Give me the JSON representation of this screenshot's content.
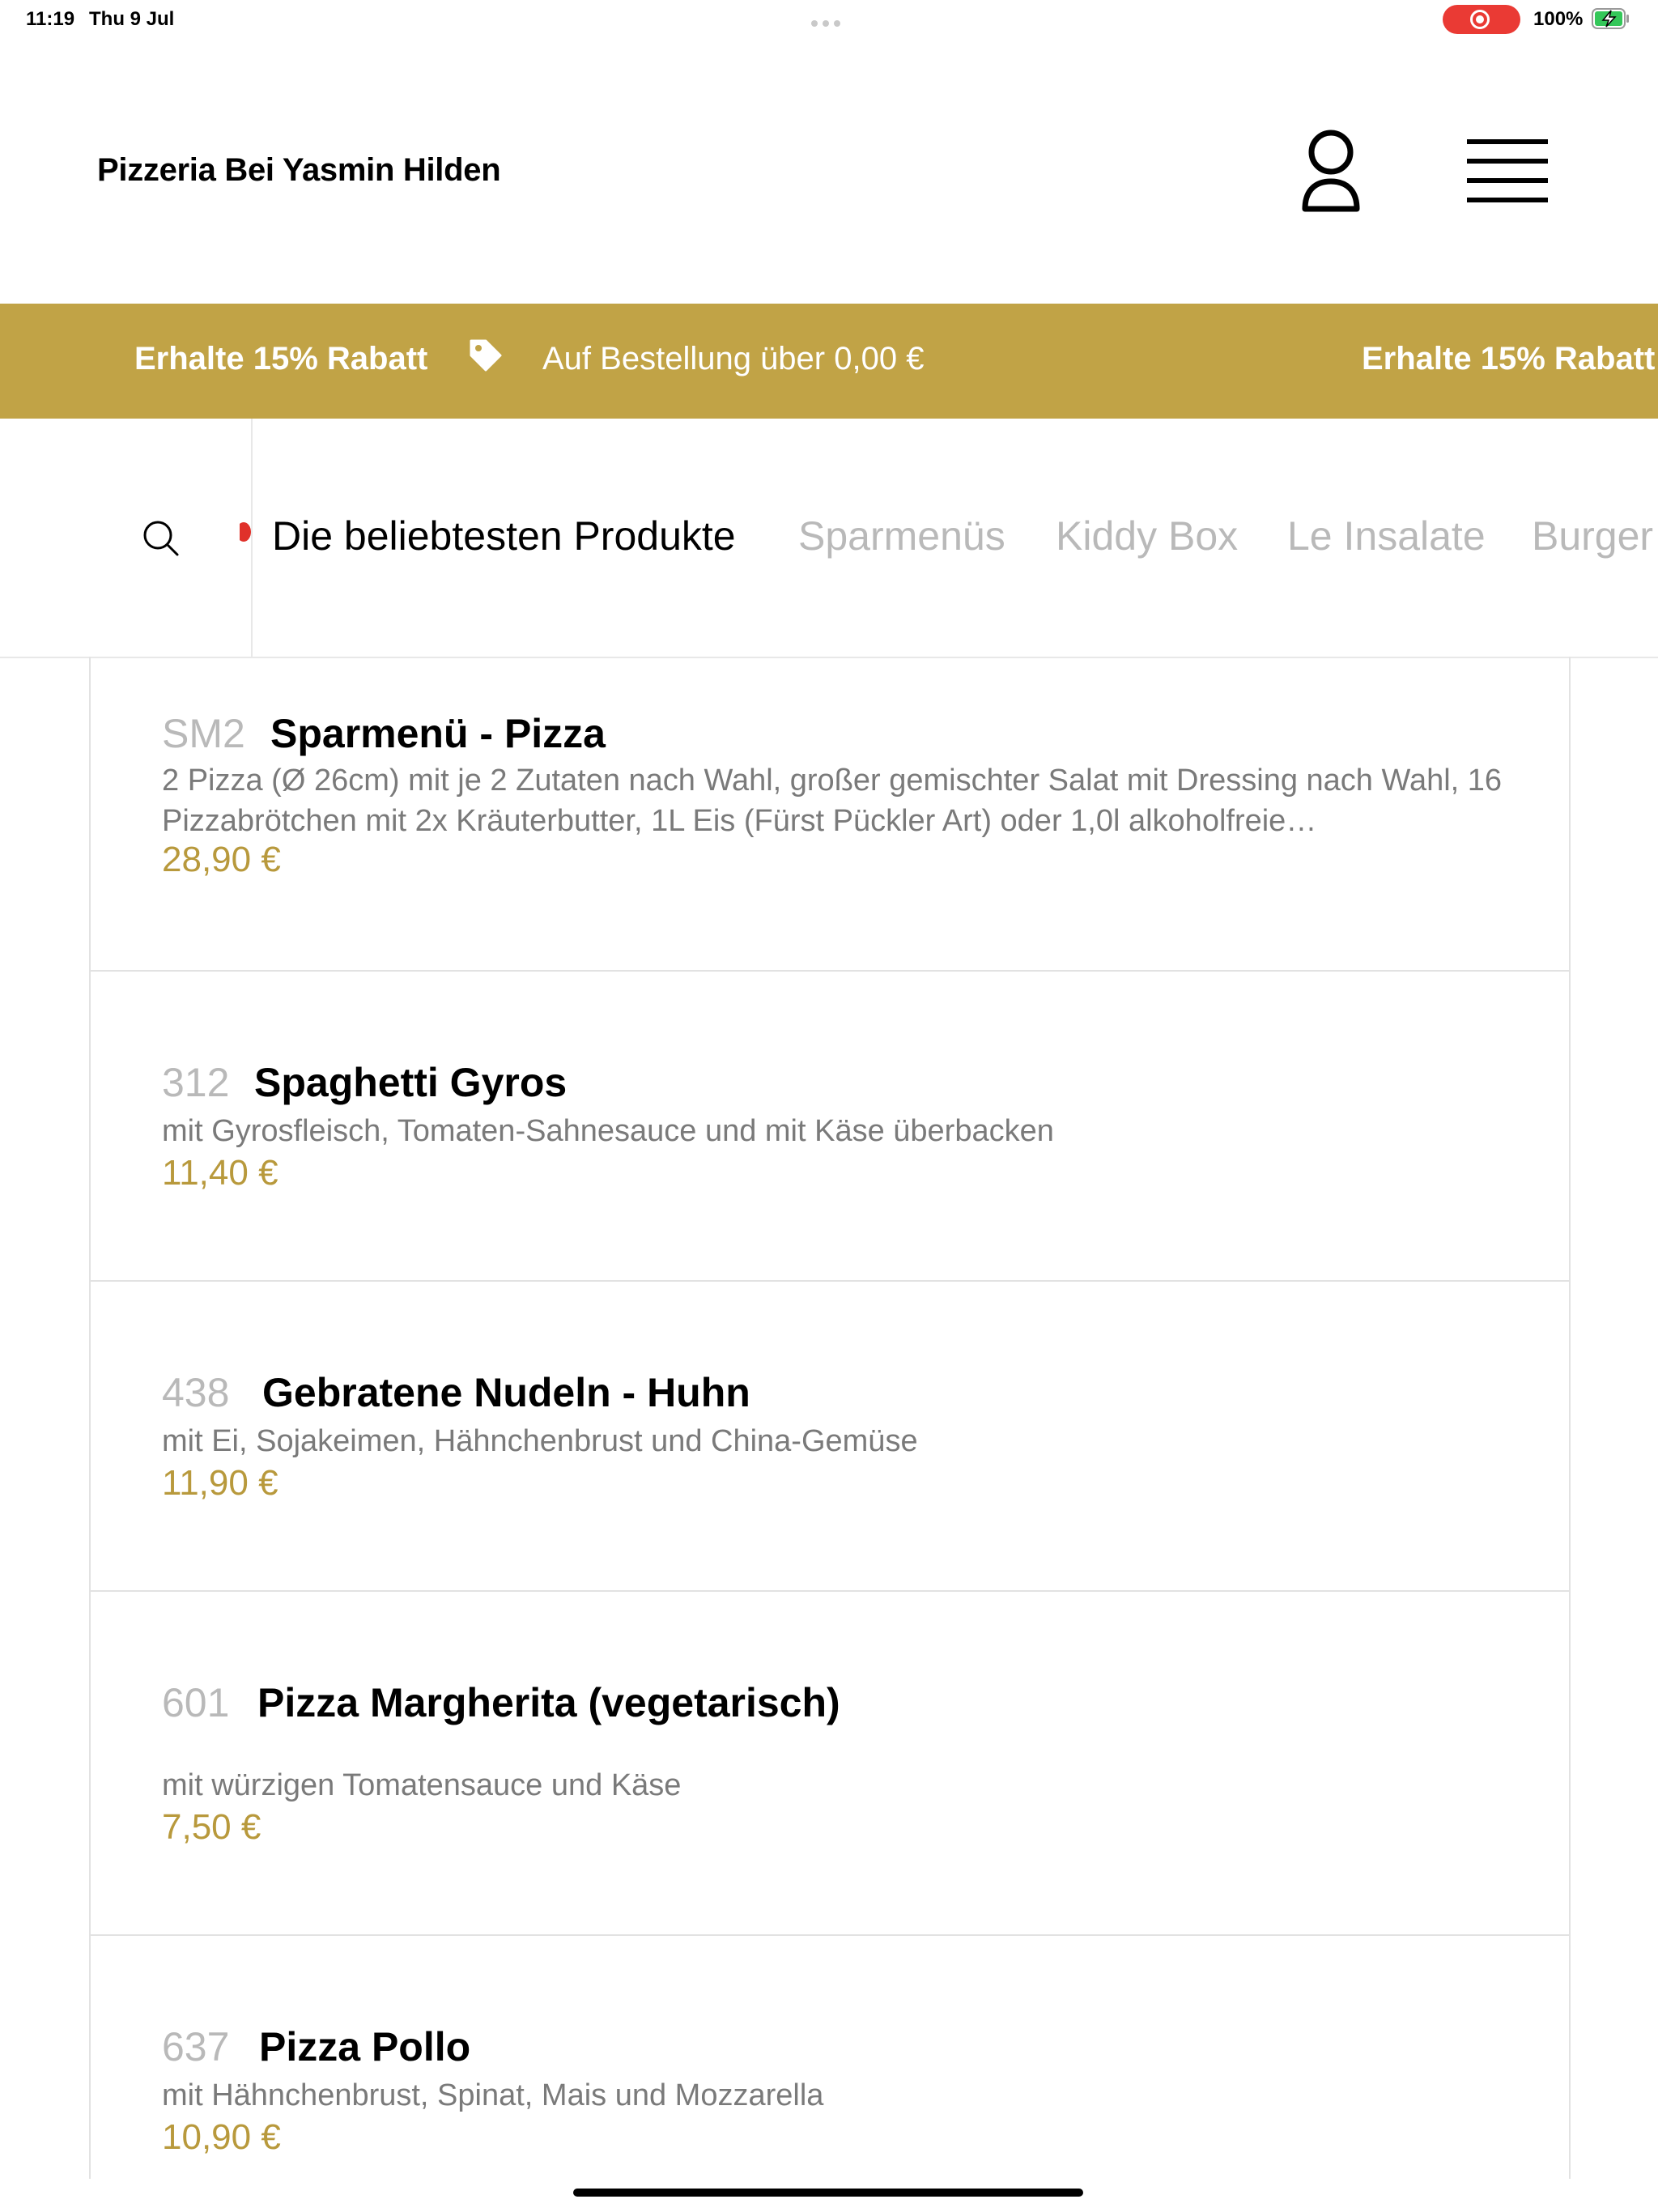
{
  "status_bar": {
    "time": "11:19",
    "date": "Thu 9 Jul",
    "battery_percent": "100%",
    "recording_color": "#ea3a34",
    "battery_color": "#34c759"
  },
  "header": {
    "title": "Pizzeria Bei Yasmin Hilden",
    "user_icon": "user-icon",
    "menu_icon": "hamburger-menu-icon"
  },
  "promo": {
    "background": "#c1a346",
    "discount_label": "Erhalte 15% Rabatt",
    "condition_label": "Auf Bestellung über 0,00 €",
    "discount_label_repeat": "Erhalte 15% Rabatt",
    "tag_icon": "tag-icon"
  },
  "categories": {
    "search_icon": "search-icon",
    "tabs": [
      {
        "label": "Die beliebtesten Produkte",
        "active": true
      },
      {
        "label": "Sparmenüs",
        "active": false
      },
      {
        "label": "Kiddy Box",
        "active": false
      },
      {
        "label": "Le Insalate",
        "active": false
      },
      {
        "label": "Burger",
        "active": false
      }
    ]
  },
  "products": [
    {
      "code": "SM2",
      "name": "Sparmenü - Pizza",
      "description": "2 Pizza (Ø 26cm) mit je 2 Zutaten nach Wahl, großer gemischter Salat mit Dressing nach Wahl, 16 Pizzabrötchen mit 2x Kräuterbutter, 1L Eis (Fürst Pückler Art) oder 1,0l alkoholfreie…",
      "price": "28,90 €"
    },
    {
      "code": "312",
      "name": "Spaghetti Gyros",
      "description": "mit Gyrosfleisch, Tomaten-Sahnesauce und mit Käse überbacken",
      "price": "11,40 €"
    },
    {
      "code": "438",
      "name": "Gebratene Nudeln - Huhn",
      "description": "mit Ei, Sojakeimen, Hähnchenbrust und China-Gemüse",
      "price": "11,90 €"
    },
    {
      "code": "601",
      "name": "Pizza Margherita (vegetarisch)",
      "description": "mit würzigen Tomatensauce und Käse",
      "price": "7,50 €"
    },
    {
      "code": "637",
      "name": "Pizza Pollo",
      "description": "mit Hähnchenbrust, Spinat, Mais und Mozzarella",
      "price": "10,90 €"
    }
  ]
}
